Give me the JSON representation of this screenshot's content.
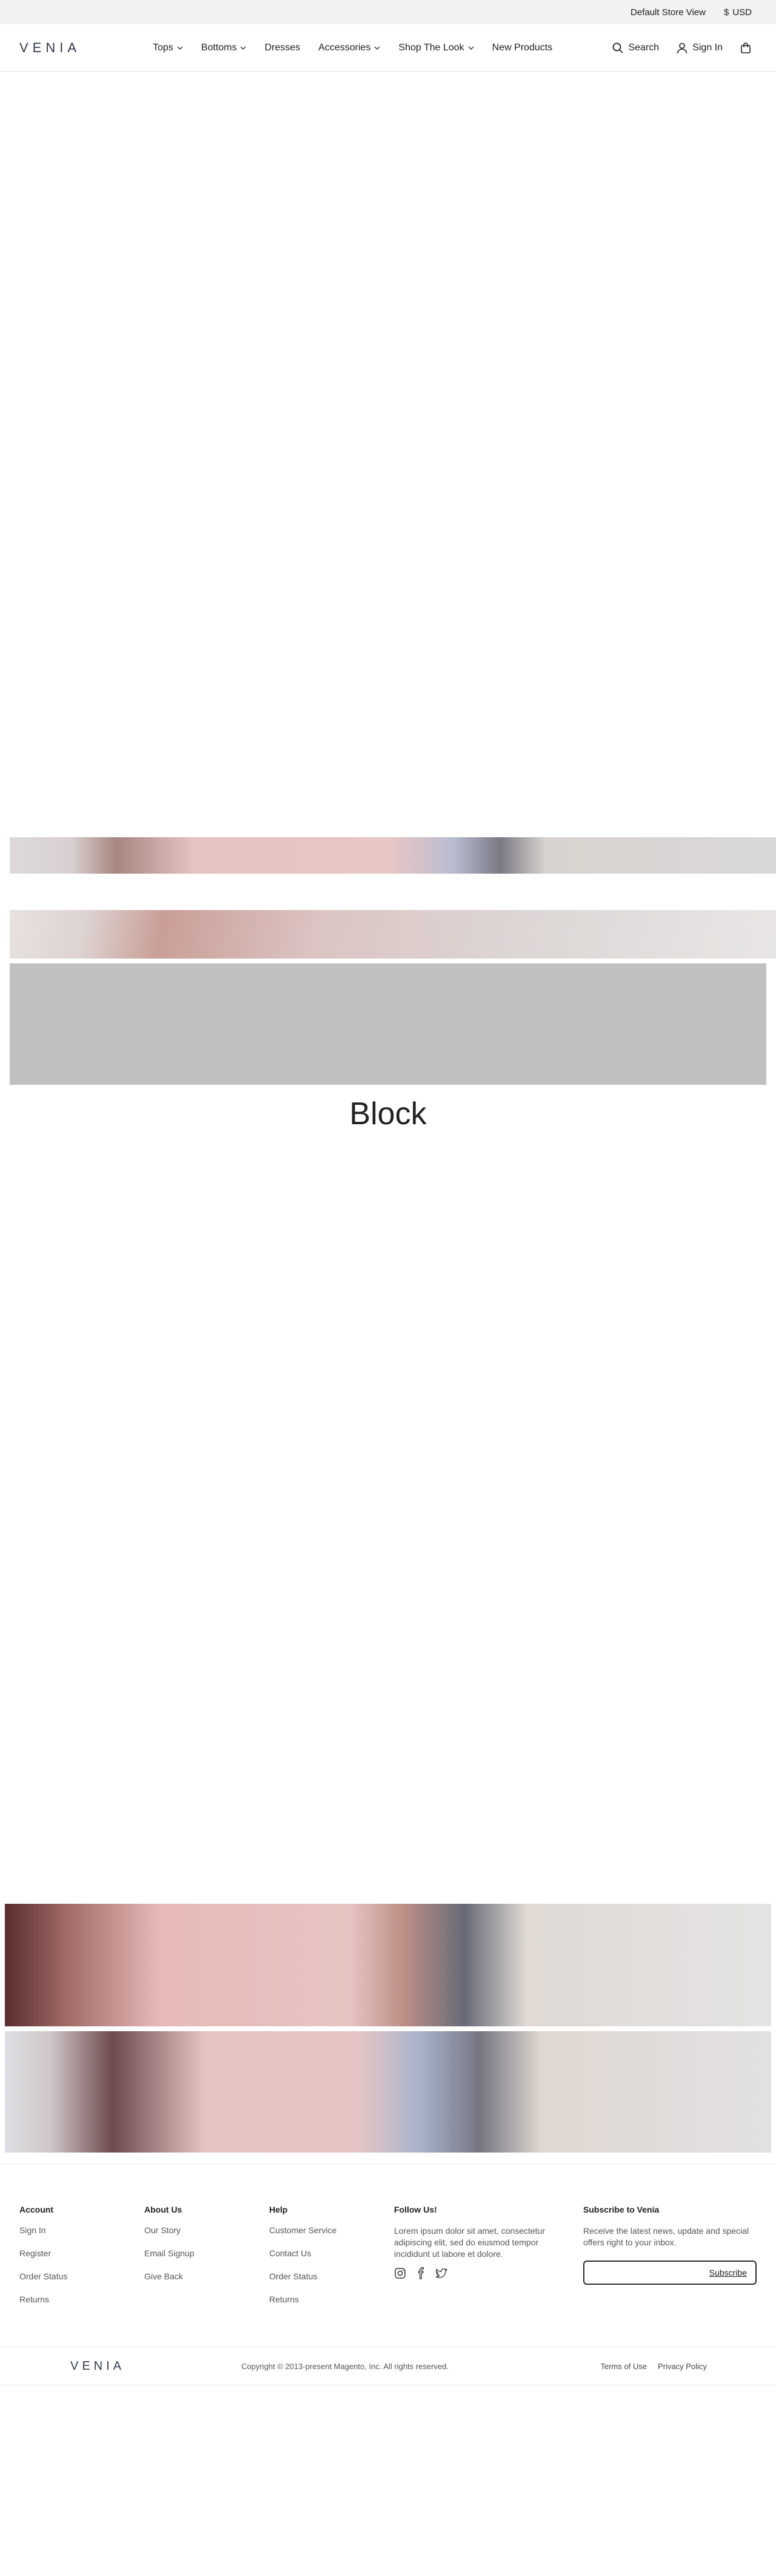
{
  "topbar": {
    "store": "Default Store View",
    "currency_symbol": "$",
    "currency": "USD"
  },
  "header": {
    "logo": "VENIA",
    "nav": [
      {
        "label": "Tops"
      },
      {
        "label": "Bottoms"
      },
      {
        "label": "Dresses"
      },
      {
        "label": "Accessories"
      },
      {
        "label": "Shop The Look"
      },
      {
        "label": "New Products"
      }
    ],
    "search_label": "Search",
    "signin_label": "Sign In"
  },
  "content": {
    "block_title": "Block"
  },
  "footer": {
    "account": {
      "title": "Account",
      "links": [
        "Sign In",
        "Register",
        "Order Status",
        "Returns"
      ]
    },
    "about": {
      "title": "About Us",
      "links": [
        "Our Story",
        "Email Signup",
        "Give Back"
      ]
    },
    "help": {
      "title": "Help",
      "links": [
        "Customer Service",
        "Contact Us",
        "Order Status",
        "Returns"
      ]
    },
    "follow": {
      "title": "Follow Us!",
      "text": "Lorem ipsum dolor sit amet, consectetur adipiscing elit, sed do eiusmod tempor incididunt ut labore et dolore."
    },
    "subscribe": {
      "title": "Subscribe to Venia",
      "text": "Receive the latest news, update and special offers right to your inbox.",
      "button": "Subscribe"
    },
    "logo": "VENIA",
    "copyright": "Copyright © 2013-present Magento, Inc. All rights reserved.",
    "terms": "Terms of Use",
    "privacy": "Privacy Policy"
  }
}
